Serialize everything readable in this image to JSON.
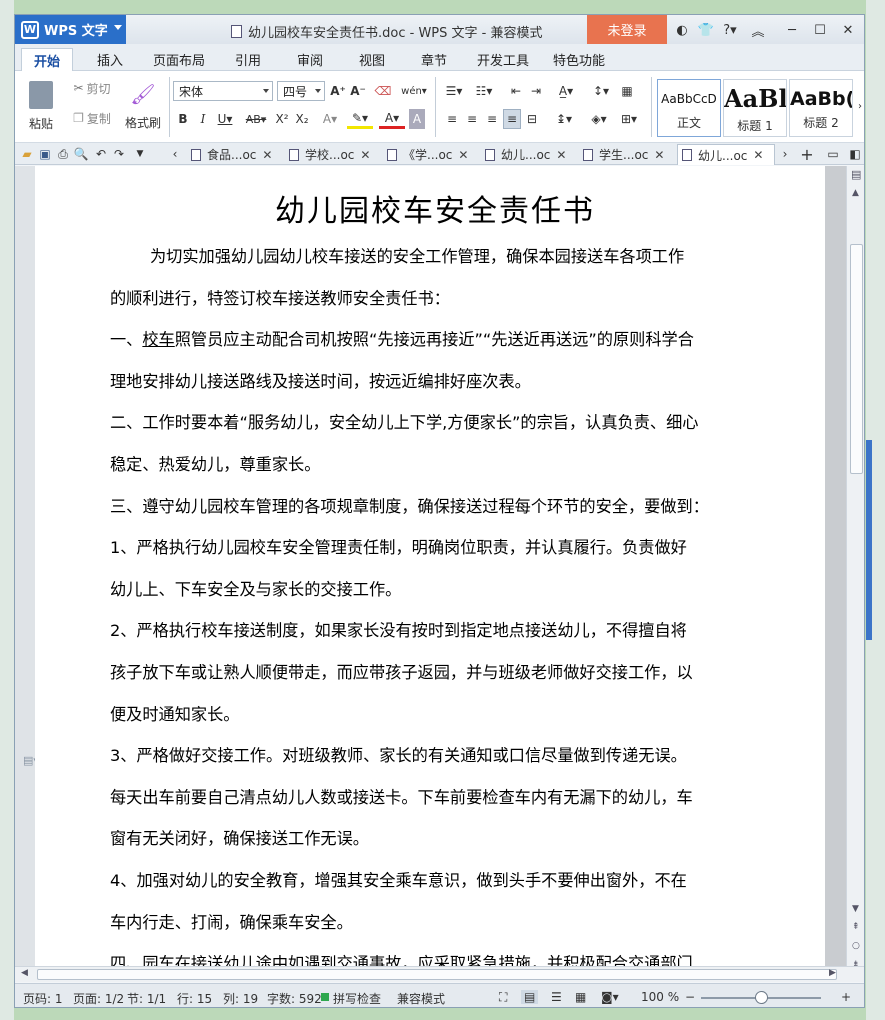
{
  "app": {
    "name": "WPS 文字",
    "logo": "W"
  },
  "window": {
    "title": "幼儿园校车安全责任书.doc - WPS 文字 - 兼容模式",
    "login_label": "未登录"
  },
  "tabs": [
    "开始",
    "插入",
    "页面布局",
    "引用",
    "审阅",
    "视图",
    "章节",
    "开发工具",
    "特色功能"
  ],
  "ribbon": {
    "paste": "粘贴",
    "cut": "剪切",
    "copy": "复制",
    "format_painter": "格式刷",
    "font_name": "宋体",
    "font_size": "四号",
    "styles": [
      {
        "preview": "AaBbCcD",
        "name": "正文"
      },
      {
        "preview": "AaBl",
        "name": "标题 1"
      },
      {
        "preview": "AaBb(",
        "name": "标题 2"
      }
    ]
  },
  "doc_tabs": [
    {
      "label": "食品...oc"
    },
    {
      "label": "学校...oc"
    },
    {
      "label": "《学...oc"
    },
    {
      "label": "幼儿...oc"
    },
    {
      "label": "学生...oc"
    },
    {
      "label": "幼儿...oc"
    }
  ],
  "document": {
    "title": "幼儿园校车安全责任书",
    "p1a": "为切实加强幼儿园幼儿校车接送的安全工作管理，确保本园接送车各项工作",
    "p1b": "的顺利进行，特签订校车接送教师安全责任书：",
    "p2a_prefix": "一、",
    "p2a_underlined": "校车",
    "p2a_rest": "照管员应主动配合司机按照“先接远再接近”“先送近再送远”的原则科学合",
    "p2b": "理地安排幼儿接送路线及接送时间，按远近编排好座次表。",
    "p3a": "二、工作时要本着“服务幼儿，安全幼儿上下学,方便家长”的宗旨，认真负责、细心",
    "p3b": "稳定、热爱幼儿，尊重家长。",
    "p4": "三、遵守幼儿园校车管理的各项规章制度，确保接送过程每个环节的安全，要做到：",
    "p5a": "1、严格执行幼儿园校车安全管理责任制，明确岗位职责，并认真履行。负责做好",
    "p5b": "幼儿上、下车安全及与家长的交接工作。",
    "p6a": "2、严格执行校车接送制度，如果家长没有按时到指定地点接送幼儿，不得擅自将",
    "p6b": "孩子放下车或让熟人顺便带走，而应带孩子返园，并与班级老师做好交接工作，以",
    "p6c": "便及时通知家长。",
    "p7a": "3、严格做好交接工作。对班级教师、家长的有关通知或口信尽量做到传递无误。",
    "p7b": "每天出车前要自己清点幼儿人数或接送卡。下车前要检查车内有无漏下的幼儿，车",
    "p7c": "窗有无关闭好，确保接送工作无误。",
    "p8a": "4、加强对幼儿的安全教育，增强其安全乘车意识，做到头手不要伸出窗外，不在",
    "p8b": "车内行走、打闹，确保乘车安全。",
    "p9a": "四、园车在接送幼儿途中如遇到交通事故，应采取紧急措施，并积极配合交通部门"
  },
  "status": {
    "page_code": "页码: 1",
    "pages": "页面: 1/2",
    "section": "节: 1/1",
    "row": "行: 15",
    "col": "列: 19",
    "words": "字数: 592",
    "spell": "拼写检查",
    "mode": "兼容模式",
    "zoom": "100 %",
    "zoom_level": 0.5
  },
  "colors": {
    "accent": "#2a6fc9",
    "login": "#e8734f",
    "ribbon_bg": "#ffffff"
  }
}
